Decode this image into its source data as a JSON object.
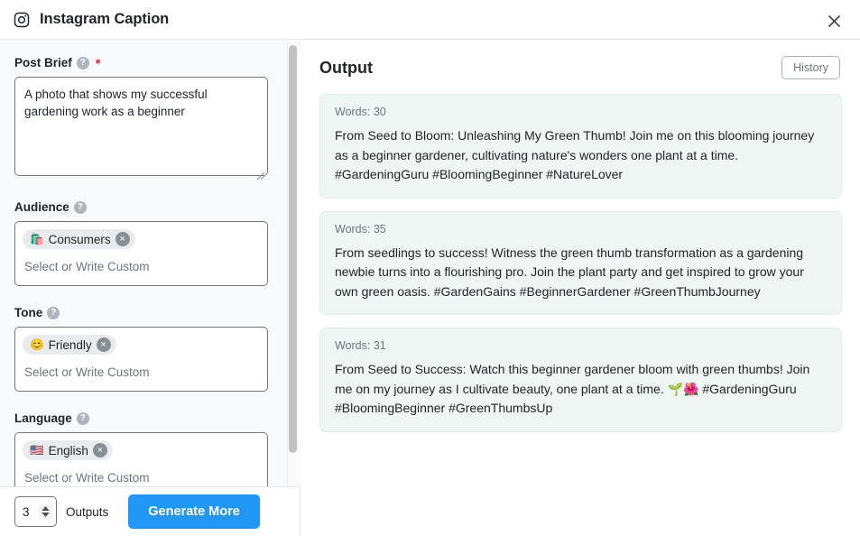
{
  "titlebar": {
    "icon": "instagram-icon",
    "title": "Instagram Caption",
    "close_label": "×"
  },
  "form": {
    "post_brief": {
      "label": "Post Brief",
      "required_marker": "*",
      "help": "?",
      "value": "A photo that shows my successful gardening work as a beginner"
    },
    "audience": {
      "label": "Audience",
      "help": "?",
      "chips": [
        {
          "emoji": "🛍️",
          "label": "Consumers",
          "remove": "×"
        }
      ],
      "placeholder": "Select or Write Custom"
    },
    "tone": {
      "label": "Tone",
      "help": "?",
      "chips": [
        {
          "emoji": "😊",
          "label": "Friendly",
          "remove": "×"
        }
      ],
      "placeholder": "Select or Write Custom"
    },
    "language": {
      "label": "Language",
      "help": "?",
      "chips": [
        {
          "emoji": "🇺🇸",
          "label": "English",
          "remove": "×"
        }
      ],
      "placeholder": "Select or Write Custom"
    }
  },
  "bottom_bar": {
    "outputs_count": "3",
    "outputs_label": "Outputs",
    "generate_label": "Generate More"
  },
  "output": {
    "title": "Output",
    "history_label": "History",
    "cards": [
      {
        "words_label": "Words: 30",
        "text": "From Seed to Bloom: Unleashing My Green Thumb! Join me on this blooming journey as a beginner gardener, cultivating nature's wonders one plant at a time. #GardeningGuru #BloomingBeginner #NatureLover"
      },
      {
        "words_label": "Words: 35",
        "text": "From seedlings to success! Witness the green thumb transformation as a gardening newbie turns into a flourishing pro. Join the plant party and get inspired to grow your own green oasis. #GardenGains #BeginnerGardener #GreenThumbJourney"
      },
      {
        "words_label": "Words: 31",
        "text": "From Seed to Success: Watch this beginner gardener bloom with green thumbs! Join me on my journey as I cultivate beauty, one plant at a time. 🌱🌺 #GardeningGuru #BloomingBeginner #GreenThumbsUp"
      }
    ]
  },
  "colors": {
    "accent": "#2196f3",
    "card_bg": "#eef7f3",
    "panel_bg": "#f8f9fb",
    "required": "#ec1c24"
  }
}
